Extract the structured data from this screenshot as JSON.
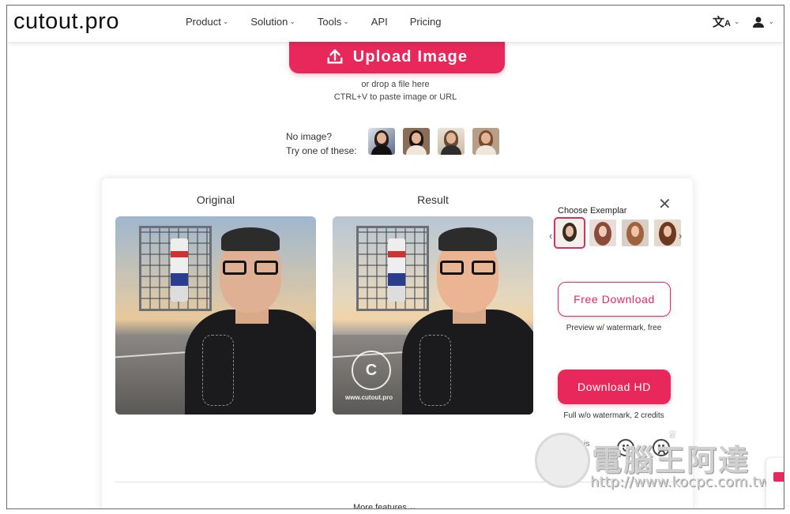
{
  "header": {
    "logo": "cutout.pro",
    "nav": [
      {
        "label": "Product",
        "dropdown": true
      },
      {
        "label": "Solution",
        "dropdown": true
      },
      {
        "label": "Tools",
        "dropdown": true
      },
      {
        "label": "API",
        "dropdown": false
      },
      {
        "label": "Pricing",
        "dropdown": false
      }
    ],
    "language_icon": "translate-icon",
    "user_icon": "user-icon"
  },
  "upload": {
    "button_label": "Upload Image",
    "drop_text": "or drop a file here",
    "paste_text": "CTRL+V to paste image or URL"
  },
  "samples": {
    "line1": "No image?",
    "line2": "Try one of these:"
  },
  "panel": {
    "original_label": "Original",
    "result_label": "Result",
    "watermark_text": "www.cutout.pro",
    "watermark_letter": "C",
    "exemplar_title": "Choose Exemplar",
    "free_button": "Free Download",
    "free_note": "Preview w/ watermark, free",
    "hd_button": "Download HD",
    "hd_note": "Full w/o watermark, 2 credits",
    "rate_text_1": "Rate this",
    "rate_text_2": "result",
    "more_features": "More features"
  },
  "overlay": {
    "site_name": "電腦王阿達",
    "site_url": "http://www.kocpc.com.tw"
  },
  "colors": {
    "accent": "#e8285a",
    "text": "#333333"
  }
}
